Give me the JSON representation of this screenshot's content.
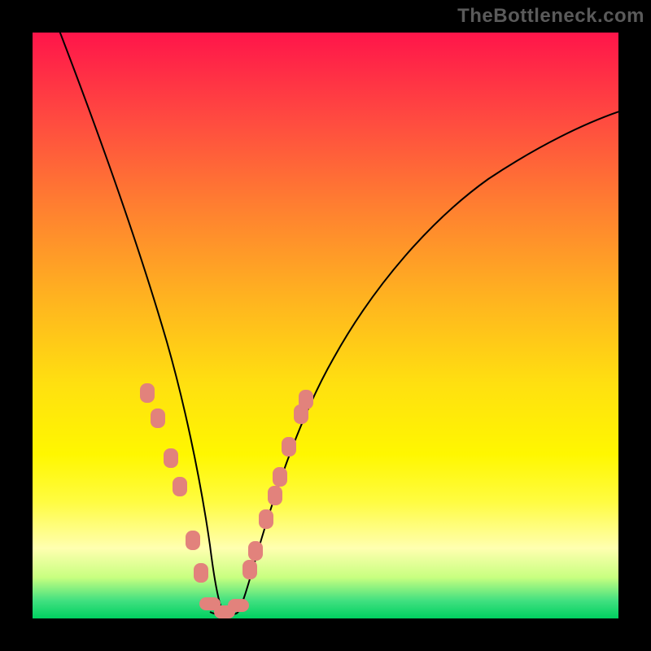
{
  "watermark": "TheBottleneck.com",
  "chart_data": {
    "type": "line",
    "title": "",
    "xlabel": "",
    "ylabel": "",
    "x": [
      0,
      0.05,
      0.1,
      0.15,
      0.2,
      0.25,
      0.275,
      0.3,
      0.31,
      0.33,
      0.37,
      0.4,
      0.45,
      0.5,
      0.6,
      0.7,
      0.8,
      0.9,
      1.0
    ],
    "values": [
      1.0,
      0.9,
      0.78,
      0.6,
      0.4,
      0.18,
      0.08,
      0.01,
      0.0,
      0.0,
      0.03,
      0.1,
      0.26,
      0.4,
      0.58,
      0.7,
      0.78,
      0.83,
      0.87
    ],
    "xlim": [
      0,
      1
    ],
    "ylim": [
      0,
      1
    ],
    "markers_left": [
      {
        "x_frac": 0.196,
        "y_frac": 0.615
      },
      {
        "x_frac": 0.214,
        "y_frac": 0.658
      },
      {
        "x_frac": 0.236,
        "y_frac": 0.727
      },
      {
        "x_frac": 0.251,
        "y_frac": 0.775
      },
      {
        "x_frac": 0.274,
        "y_frac": 0.867
      },
      {
        "x_frac": 0.287,
        "y_frac": 0.922
      }
    ],
    "markers_right": [
      {
        "x_frac": 0.371,
        "y_frac": 0.917
      },
      {
        "x_frac": 0.38,
        "y_frac": 0.885
      },
      {
        "x_frac": 0.399,
        "y_frac": 0.831
      },
      {
        "x_frac": 0.414,
        "y_frac": 0.79
      },
      {
        "x_frac": 0.422,
        "y_frac": 0.758
      },
      {
        "x_frac": 0.438,
        "y_frac": 0.707
      },
      {
        "x_frac": 0.458,
        "y_frac": 0.651
      },
      {
        "x_frac": 0.466,
        "y_frac": 0.627
      }
    ],
    "markers_bottom": [
      {
        "x_frac": 0.303,
        "y_frac": 0.975
      },
      {
        "x_frac": 0.327,
        "y_frac": 0.989
      },
      {
        "x_frac": 0.352,
        "y_frac": 0.978
      }
    ]
  }
}
